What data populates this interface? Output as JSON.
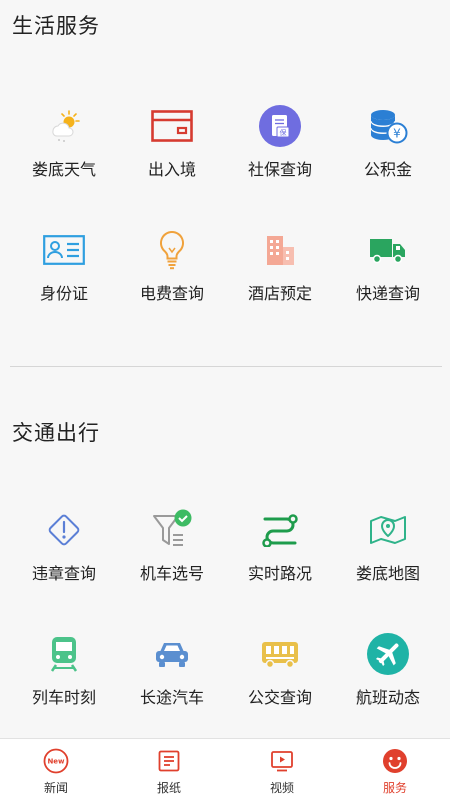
{
  "colors": {
    "accent": "#e0402d",
    "text": "#222222",
    "background": "#f7f7f7"
  },
  "sections": [
    {
      "title": "生活服务",
      "items": [
        {
          "label": "娄底天气",
          "icon": "weather-icon"
        },
        {
          "label": "出入境",
          "icon": "card-icon"
        },
        {
          "label": "社保查询",
          "icon": "social-security-icon"
        },
        {
          "label": "公积金",
          "icon": "coins-yen-icon"
        },
        {
          "label": "身份证",
          "icon": "id-card-icon"
        },
        {
          "label": "电费查询",
          "icon": "lightbulb-icon"
        },
        {
          "label": "酒店预定",
          "icon": "building-icon"
        },
        {
          "label": "快递查询",
          "icon": "truck-icon"
        }
      ]
    },
    {
      "title": "交通出行",
      "items": [
        {
          "label": "违章查询",
          "icon": "warning-diamond-icon"
        },
        {
          "label": "机车选号",
          "icon": "filter-check-icon"
        },
        {
          "label": "实时路况",
          "icon": "route-icon"
        },
        {
          "label": "娄底地图",
          "icon": "map-pin-icon"
        },
        {
          "label": "列车时刻",
          "icon": "train-icon"
        },
        {
          "label": "长途汽车",
          "icon": "car-icon"
        },
        {
          "label": "公交查询",
          "icon": "bus-icon"
        },
        {
          "label": "航班动态",
          "icon": "airplane-icon"
        }
      ]
    }
  ],
  "tabs": [
    {
      "label": "新闻",
      "icon": "news-new-icon",
      "badge": "New"
    },
    {
      "label": "报纸",
      "icon": "newspaper-icon"
    },
    {
      "label": "视频",
      "icon": "video-icon"
    },
    {
      "label": "服务",
      "icon": "smiley-service-icon",
      "active": true
    }
  ]
}
